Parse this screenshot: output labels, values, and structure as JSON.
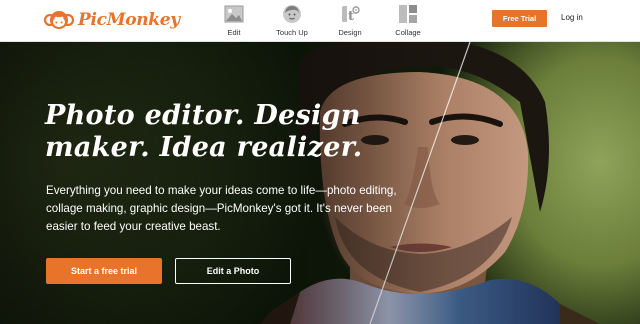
{
  "brand": {
    "name": "PicMonkey",
    "accent": "#e8732a"
  },
  "nav": {
    "items": [
      {
        "label": "Edit",
        "icon": "image-icon"
      },
      {
        "label": "Touch Up",
        "icon": "face-icon"
      },
      {
        "label": "Design",
        "icon": "design-icon"
      },
      {
        "label": "Collage",
        "icon": "collage-icon"
      }
    ]
  },
  "header": {
    "free_trial_label": "Free Trial",
    "login_label": "Log in"
  },
  "hero": {
    "title": "Photo editor. Design maker. Idea realizer.",
    "subtitle": "Everything you need to make your ideas come to life—photo editing, collage making, graphic design—PicMonkey's got it. It's never been easier to feed your creative beast.",
    "primary_cta": "Start a free trial",
    "secondary_cta": "Edit a Photo"
  }
}
